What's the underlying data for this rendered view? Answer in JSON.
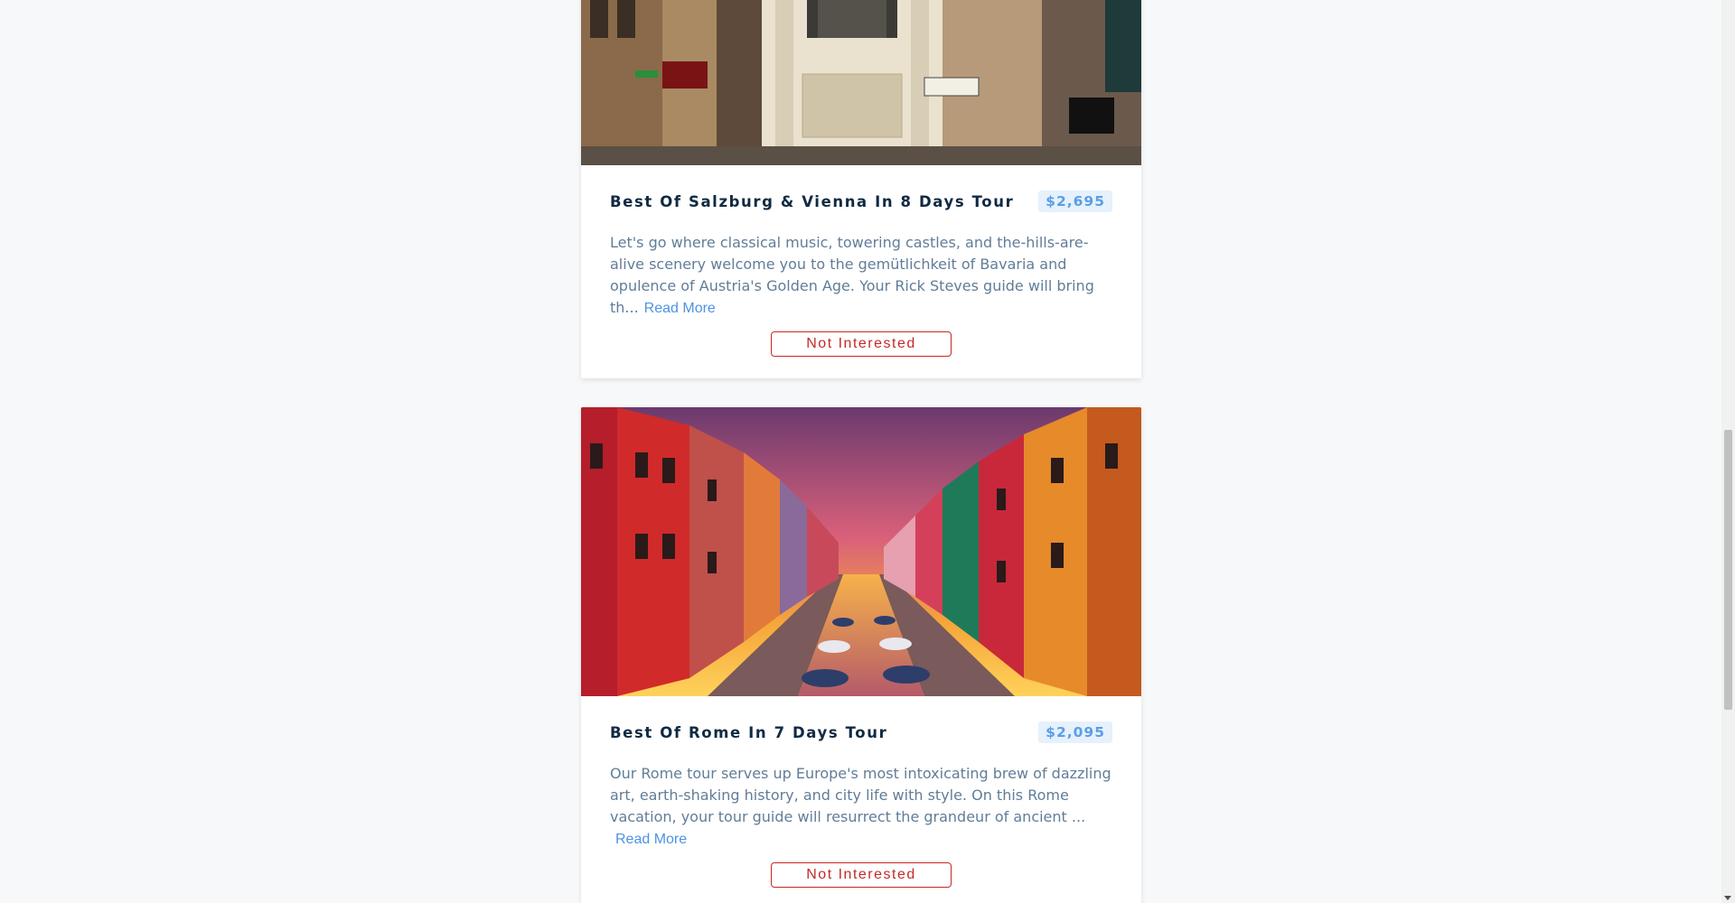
{
  "tours": [
    {
      "image_alt": "vienna-street-photo",
      "title": "Best Of Salzburg & Vienna In 8 Days Tour",
      "price": "$2,695",
      "description": "Let's go where classical music, towering castles, and the-hills-are-alive scenery welcome you to the gemütlichkeit of Bavaria and opulence of Austria's Golden Age. Your Rick Steves guide will bring th...",
      "read_more": "Read More",
      "not_interested": "Not Interested"
    },
    {
      "image_alt": "venice-burano-canal-photo",
      "title": "Best Of Rome In 7 Days Tour",
      "price": "$2,095",
      "description": "Our Rome tour serves up Europe's most intoxicating brew of dazzling art, earth-shaking history, and city life with style. On this Rome vacation, your tour guide will resurrect the grandeur of ancient ...",
      "read_more": "Read More",
      "not_interested": "Not Interested"
    }
  ],
  "colors": {
    "title": "#102a43",
    "price_text": "#5a9ee8",
    "price_bg": "#e6f1fb",
    "link": "#4b93e6",
    "danger": "#c62828",
    "page_bg": "#f7f8fa"
  }
}
